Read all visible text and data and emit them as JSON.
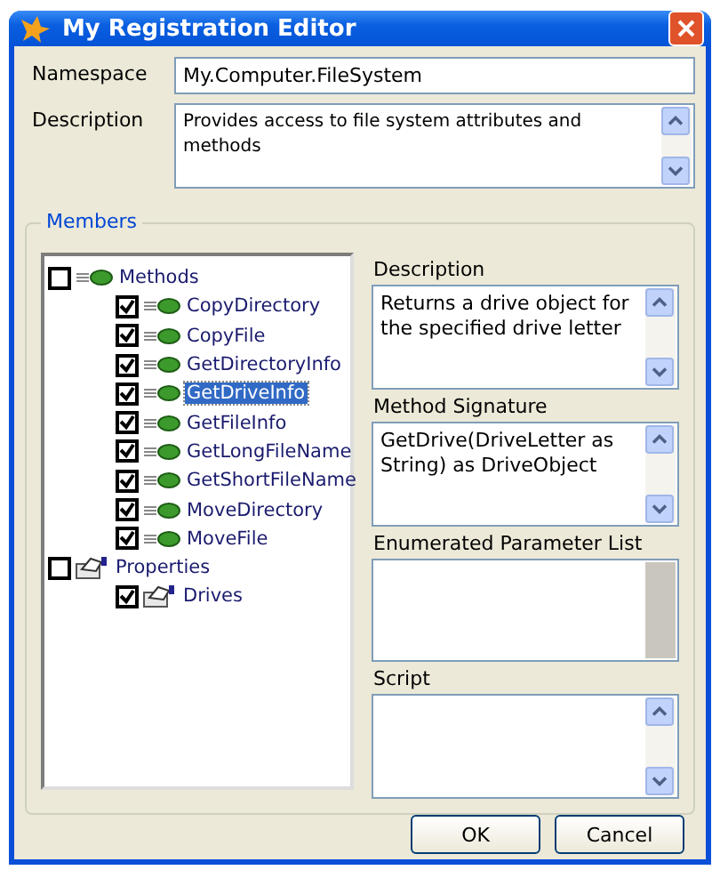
{
  "window": {
    "title": "My Registration Editor"
  },
  "namespace": {
    "label": "Namespace",
    "value": "My.Computer.FileSystem"
  },
  "description": {
    "label": "Description",
    "value": "Provides access to file system attributes and methods",
    "scroll_enabled": true
  },
  "members": {
    "title": "Members",
    "tree": [
      {
        "label": "Methods",
        "kind": "method",
        "checked": false,
        "selected": false,
        "children": [
          {
            "label": "CopyDirectory",
            "kind": "method",
            "checked": true,
            "selected": false
          },
          {
            "label": "CopyFile",
            "kind": "method",
            "checked": true,
            "selected": false
          },
          {
            "label": "GetDirectoryInfo",
            "kind": "method",
            "checked": true,
            "selected": false
          },
          {
            "label": "GetDriveInfo",
            "kind": "method",
            "checked": true,
            "selected": true
          },
          {
            "label": "GetFileInfo",
            "kind": "method",
            "checked": true,
            "selected": false
          },
          {
            "label": "GetLongFileName",
            "kind": "method",
            "checked": true,
            "selected": false
          },
          {
            "label": "GetShortFileName",
            "kind": "method",
            "checked": true,
            "selected": false
          },
          {
            "label": "MoveDirectory",
            "kind": "method",
            "checked": true,
            "selected": false
          },
          {
            "label": "MoveFile",
            "kind": "method",
            "checked": true,
            "selected": false
          }
        ]
      },
      {
        "label": "Properties",
        "kind": "property",
        "checked": false,
        "selected": false,
        "children": [
          {
            "label": "Drives",
            "kind": "property",
            "checked": true,
            "selected": false
          }
        ]
      }
    ],
    "fields": [
      {
        "label": "Description",
        "value": "Returns a drive object for the specified drive letter",
        "scroll_enabled": true
      },
      {
        "label": "Method Signature",
        "value": "GetDrive(DriveLetter as String) as DriveObject",
        "scroll_enabled": true
      },
      {
        "label": "Enumerated Parameter List",
        "scroll_enabled": false
      },
      {
        "label": "Script",
        "scroll_enabled": true
      }
    ]
  },
  "buttons": [
    "OK",
    "Cancel"
  ]
}
